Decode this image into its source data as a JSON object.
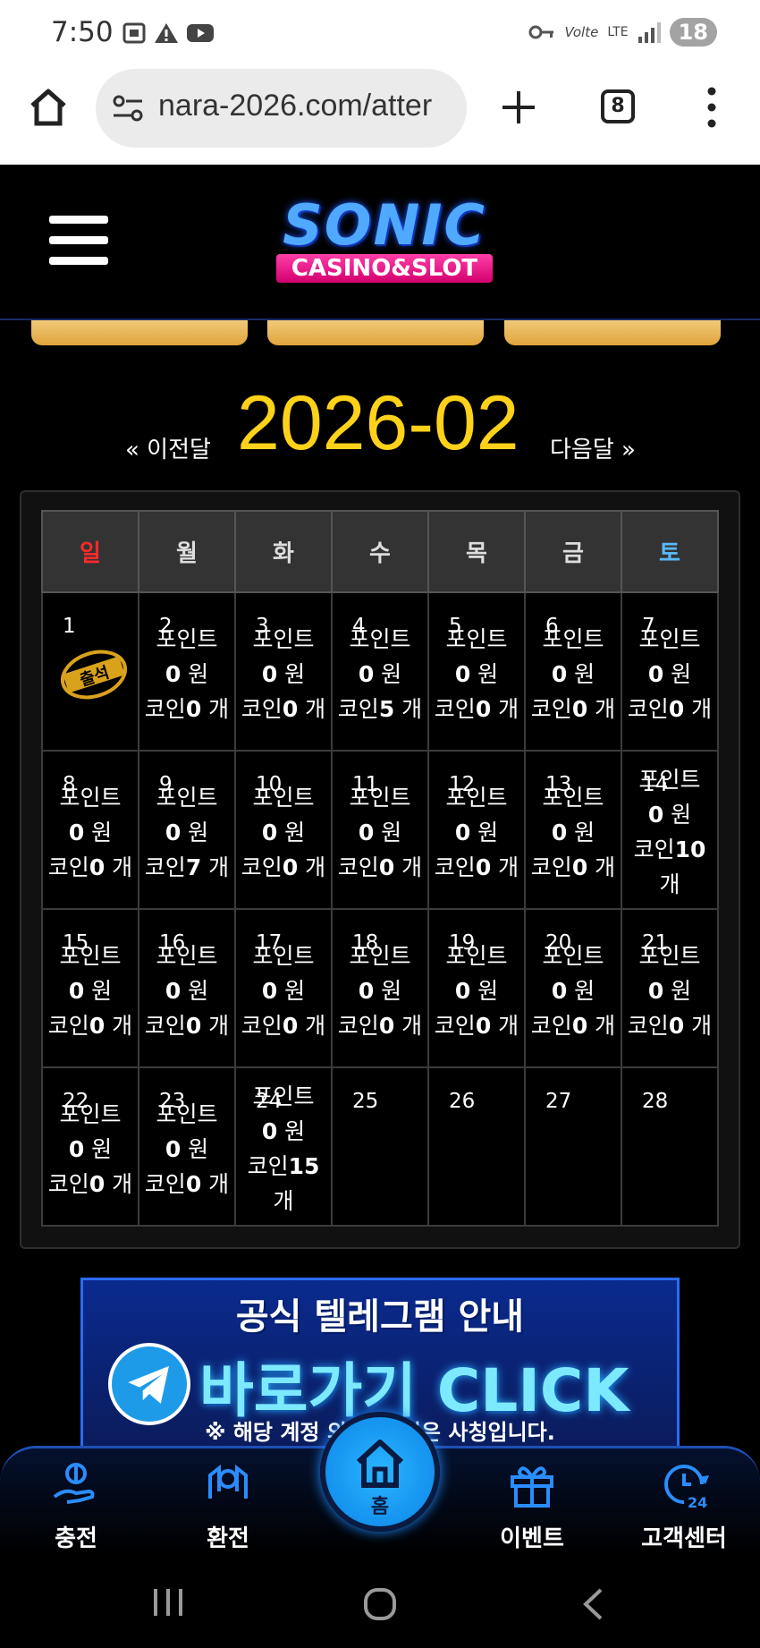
{
  "status_bar": {
    "time": "7:50",
    "network": "LTE",
    "volte": "Volte",
    "battery": "18"
  },
  "browser": {
    "url": "nara-2026.com/atter",
    "tab_count": "8"
  },
  "site": {
    "logo_main": "SONIC",
    "logo_sub": "CASINO&SLOT"
  },
  "calendar_nav": {
    "prev_label": "« 이전달",
    "month": "2026-02",
    "next_label": "다음달 »"
  },
  "calendar": {
    "weekdays": [
      "일",
      "월",
      "화",
      "수",
      "목",
      "금",
      "토"
    ],
    "point_label": "포인트",
    "won_unit": "원",
    "coin_label": "코인",
    "coin_unit": "개",
    "stamp_text": "출석",
    "days": [
      {
        "day": "1",
        "stamp": true
      },
      {
        "day": "2",
        "point": "0",
        "coin": "0"
      },
      {
        "day": "3",
        "point": "0",
        "coin": "0"
      },
      {
        "day": "4",
        "point": "0",
        "coin": "5"
      },
      {
        "day": "5",
        "point": "0",
        "coin": "0"
      },
      {
        "day": "6",
        "point": "0",
        "coin": "0"
      },
      {
        "day": "7",
        "point": "0",
        "coin": "0"
      },
      {
        "day": "8",
        "point": "0",
        "coin": "0"
      },
      {
        "day": "9",
        "point": "0",
        "coin": "7"
      },
      {
        "day": "10",
        "point": "0",
        "coin": "0"
      },
      {
        "day": "11",
        "point": "0",
        "coin": "0"
      },
      {
        "day": "12",
        "point": "0",
        "coin": "0"
      },
      {
        "day": "13",
        "point": "0",
        "coin": "0"
      },
      {
        "day": "14",
        "point": "0",
        "coin": "10"
      },
      {
        "day": "15",
        "point": "0",
        "coin": "0"
      },
      {
        "day": "16",
        "point": "0",
        "coin": "0"
      },
      {
        "day": "17",
        "point": "0",
        "coin": "0"
      },
      {
        "day": "18",
        "point": "0",
        "coin": "0"
      },
      {
        "day": "19",
        "point": "0",
        "coin": "0"
      },
      {
        "day": "20",
        "point": "0",
        "coin": "0"
      },
      {
        "day": "21",
        "point": "0",
        "coin": "0"
      },
      {
        "day": "22",
        "point": "0",
        "coin": "0"
      },
      {
        "day": "23",
        "point": "0",
        "coin": "0"
      },
      {
        "day": "24",
        "point": "0",
        "coin": "15"
      },
      {
        "day": "25"
      },
      {
        "day": "26"
      },
      {
        "day": "27"
      },
      {
        "day": "28"
      }
    ]
  },
  "banner": {
    "line1": "공식 텔레그램 안내",
    "line2": "바로가기 CLICK",
    "line3": "※ 해당 계정 외 보 채널은 사칭입니다."
  },
  "bottom_nav": {
    "charge": "충전",
    "exchange": "환전",
    "home": "홈",
    "event": "이벤트",
    "support": "고객센터"
  }
}
